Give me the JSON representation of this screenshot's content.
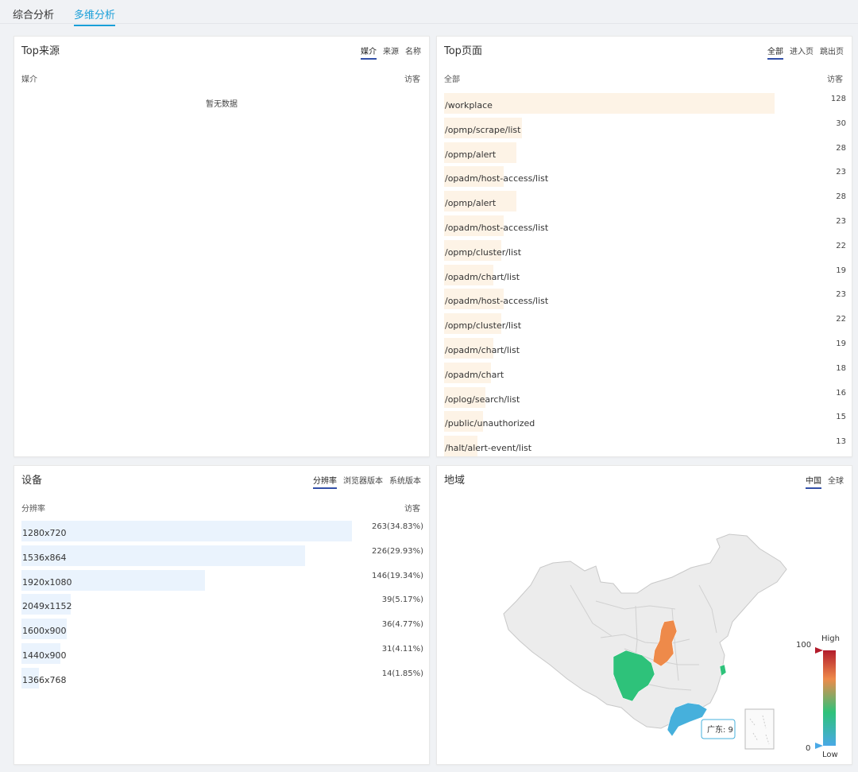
{
  "main_tabs": [
    {
      "label": "综合分析"
    },
    {
      "label": "多维分析"
    }
  ],
  "top_sources": {
    "title": "Top来源",
    "tabs": [
      "媒介",
      "来源",
      "名称"
    ],
    "col_left": "媒介",
    "col_right": "访客",
    "empty": "暂无数据"
  },
  "top_pages": {
    "title": "Top页面",
    "tabs": [
      "全部",
      "进入页",
      "跳出页"
    ],
    "col_left": "全部",
    "col_right": "访客",
    "rows": [
      {
        "path": "/workplace",
        "visitors": 128
      },
      {
        "path": "/opmp/scrape/list",
        "visitors": 30
      },
      {
        "path": "/opmp/alert",
        "visitors": 28
      },
      {
        "path": "/opadm/host-access/list",
        "visitors": 23
      },
      {
        "path": "/opmp/alert",
        "visitors": 28
      },
      {
        "path": "/opadm/host-access/list",
        "visitors": 23
      },
      {
        "path": "/opmp/cluster/list",
        "visitors": 22
      },
      {
        "path": "/opadm/chart/list",
        "visitors": 19
      },
      {
        "path": "/opadm/host-access/list",
        "visitors": 23
      },
      {
        "path": "/opmp/cluster/list",
        "visitors": 22
      },
      {
        "path": "/opadm/chart/list",
        "visitors": 19
      },
      {
        "path": "/opadm/chart",
        "visitors": 18
      },
      {
        "path": "/oplog/search/list",
        "visitors": 16
      },
      {
        "path": "/public/unauthorized",
        "visitors": 15
      },
      {
        "path": "/halt/alert-event/list",
        "visitors": 13
      }
    ]
  },
  "devices": {
    "title": "设备",
    "tabs": [
      "分辨率",
      "浏览器版本",
      "系统版本"
    ],
    "col_left": "分辨率",
    "col_right": "访客",
    "rows": [
      {
        "res": "1280x720",
        "value": "263(34.83%)",
        "pct": 34.83
      },
      {
        "res": "1536x864",
        "value": "226(29.93%)",
        "pct": 29.93
      },
      {
        "res": "1920x1080",
        "value": "146(19.34%)",
        "pct": 19.34
      },
      {
        "res": "2049x1152",
        "value": "39(5.17%)",
        "pct": 5.17
      },
      {
        "res": "1600x900",
        "value": "36(4.77%)",
        "pct": 4.77
      },
      {
        "res": "1440x900",
        "value": "31(4.11%)",
        "pct": 4.11
      },
      {
        "res": "1366x768",
        "value": "14(1.85%)",
        "pct": 1.85
      }
    ]
  },
  "region": {
    "title": "地域",
    "tabs": [
      "中国",
      "全球"
    ],
    "legend": {
      "high_label": "High",
      "low_label": "Low",
      "max": "100",
      "min": "0"
    },
    "tooltip": "广东: 9",
    "colors": {
      "base": "#ececec",
      "shaanxi": "#ee8a4a",
      "sichuan": "#2ec27a",
      "guangdong": "#46b0dc",
      "zhejiang": "#2ec27a"
    }
  },
  "colors": {
    "accent": "#1a9fd8",
    "tab_underline": "#3350a8",
    "page_bar": "#fdf3e6",
    "device_bar": "#eaf3fd"
  }
}
